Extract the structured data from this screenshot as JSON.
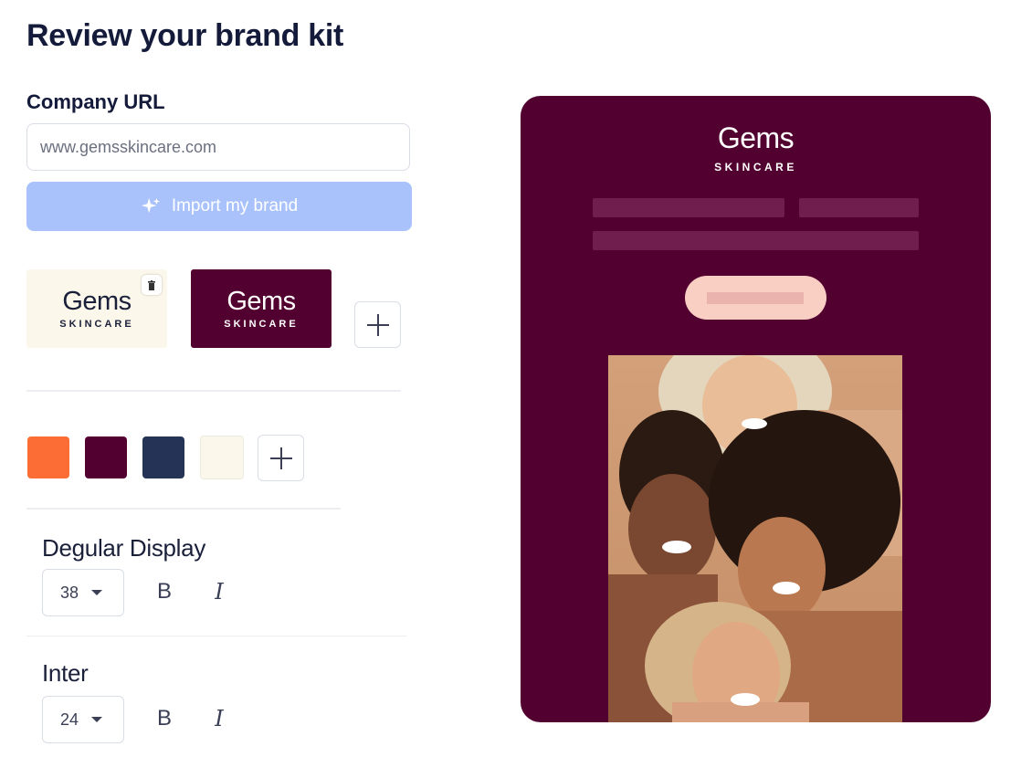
{
  "page": {
    "title": "Review your brand kit"
  },
  "company_url": {
    "label": "Company URL",
    "value": "www.gemsskincare.com",
    "import_label": "Import my brand"
  },
  "logos": {
    "items": [
      {
        "word": "Gems",
        "sub": "SKINCARE",
        "bg": "#fbf7ea",
        "fg": "#1a1f3a"
      },
      {
        "word": "Gems",
        "sub": "SKINCARE",
        "bg": "#520030",
        "fg": "#ffffff"
      }
    ]
  },
  "colors": {
    "swatches": [
      "#fb6d35",
      "#520030",
      "#243356",
      "#fbf7ea"
    ]
  },
  "fonts": [
    {
      "name": "Degular Display",
      "size": "38",
      "bold": "B",
      "italic": "I"
    },
    {
      "name": "Inter",
      "size": "24",
      "bold": "B",
      "italic": "I"
    }
  ],
  "preview": {
    "brand_word": "Gems",
    "brand_sub": "SKINCARE",
    "bg": "#520030",
    "button_color": "#f9cfc4"
  }
}
